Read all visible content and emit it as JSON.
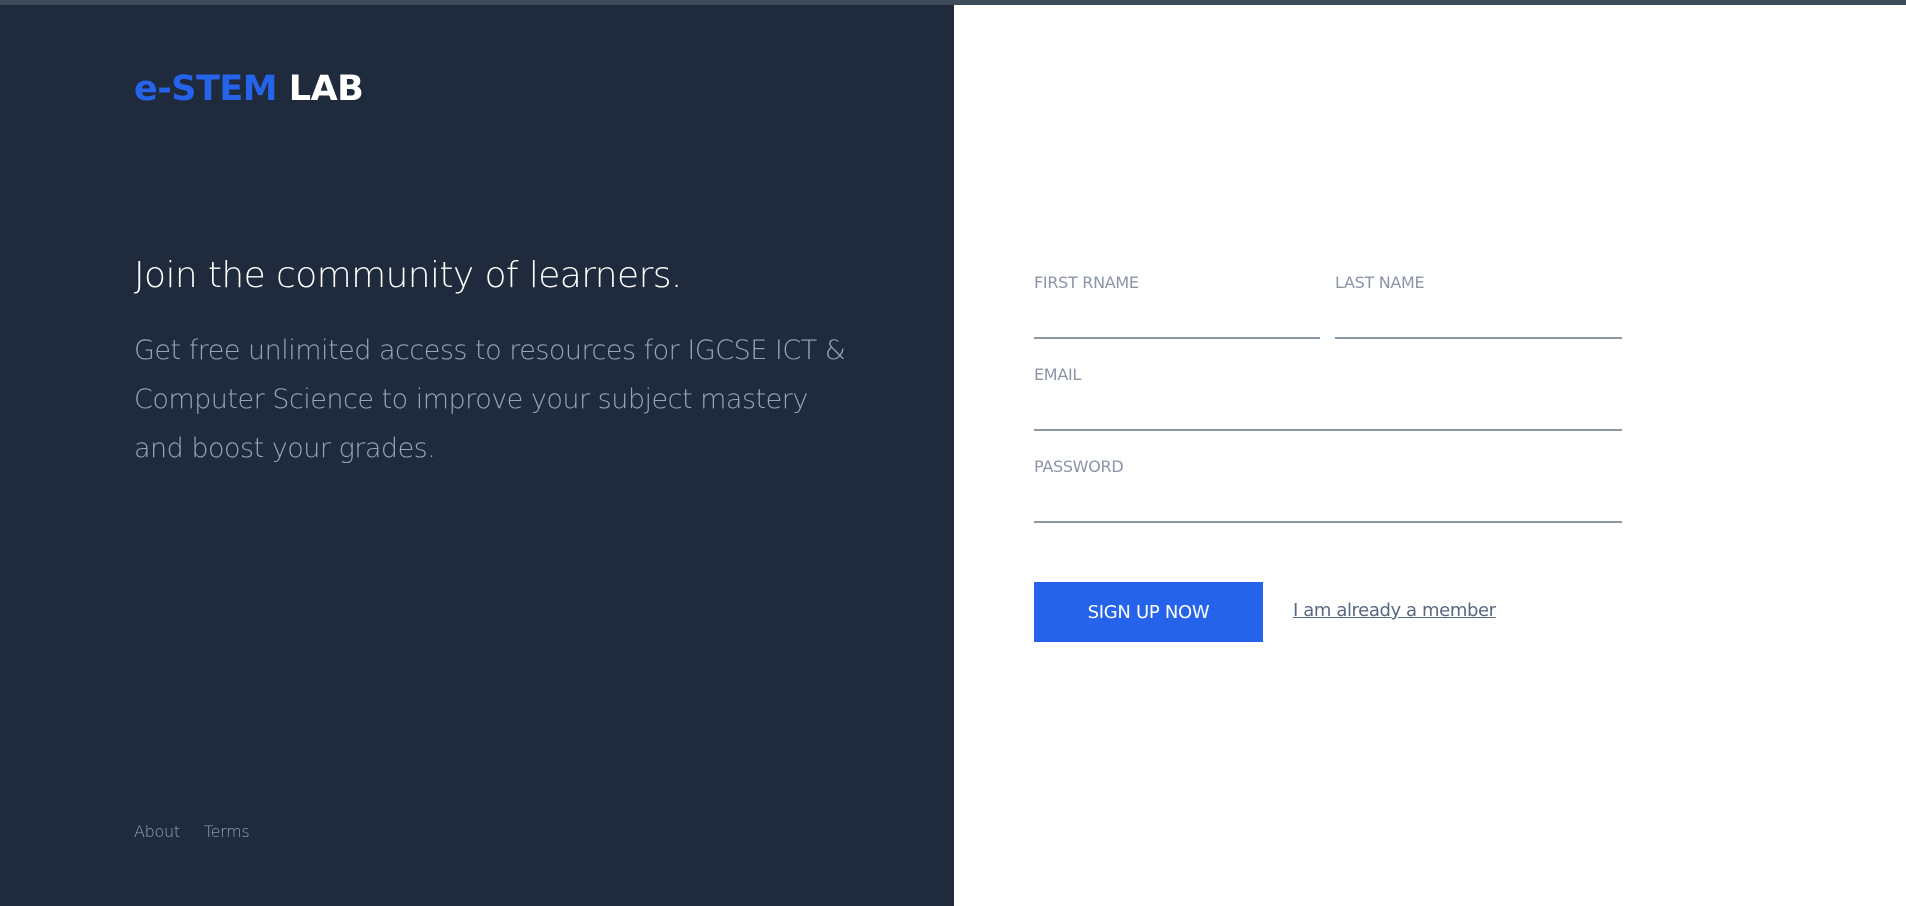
{
  "brand": {
    "accent_text": "e-STEM",
    "rest_text": "LAB",
    "accent_color": "#2563eb"
  },
  "hero": {
    "headline": "Join the community of learners.",
    "description": "Get free unlimited access to resources for IGCSE ICT & Computer Science to improve your subject mastery and boost your grades."
  },
  "footer": {
    "about_label": "About",
    "terms_label": "Terms"
  },
  "form": {
    "first_name": {
      "label": "FIRST RNAME",
      "value": ""
    },
    "last_name": {
      "label": "LAST NAME",
      "value": ""
    },
    "email": {
      "label": "EMAIL",
      "value": ""
    },
    "password": {
      "label": "PASSWORD",
      "value": ""
    },
    "submit_label": "SIGN UP NOW",
    "member_link_label": "I am already a member"
  },
  "colors": {
    "left_panel_bg": "#1f2a3c",
    "button_bg": "#2563eb"
  }
}
